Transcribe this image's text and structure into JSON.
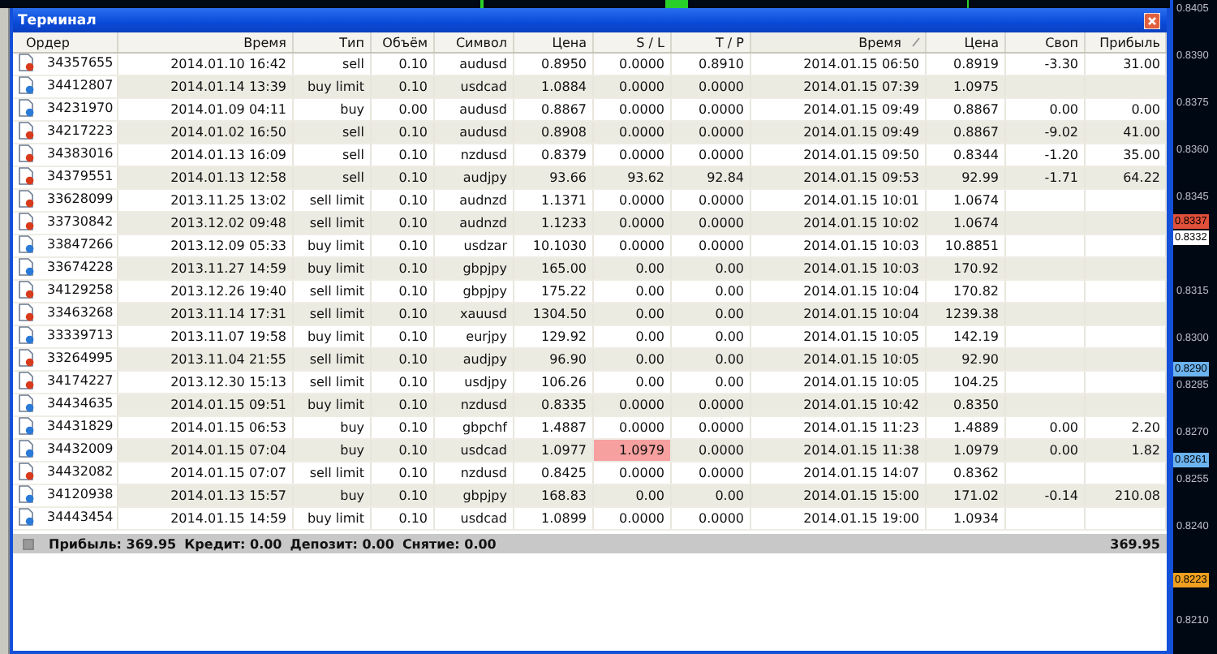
{
  "window": {
    "title": "Терминал"
  },
  "columns": [
    {
      "label": "Ордер",
      "sorted": false
    },
    {
      "label": "Время",
      "sorted": false
    },
    {
      "label": "Тип",
      "sorted": false
    },
    {
      "label": "Объём",
      "sorted": false
    },
    {
      "label": "Символ",
      "sorted": false
    },
    {
      "label": "Цена",
      "sorted": false
    },
    {
      "label": "S / L",
      "sorted": false
    },
    {
      "label": "T / P",
      "sorted": false
    },
    {
      "label": "Время",
      "sorted": true
    },
    {
      "label": "Цена",
      "sorted": false
    },
    {
      "label": "Своп",
      "sorted": false
    },
    {
      "label": "Прибыль",
      "sorted": false
    }
  ],
  "rows": [
    {
      "color": "#d83a1c",
      "sl_alert": false,
      "cells": [
        "34357655",
        "2014.01.10 16:42",
        "sell",
        "0.10",
        "audusd",
        "0.8950",
        "0.0000",
        "0.8910",
        "2014.01.15 06:50",
        "0.8919",
        "-3.30",
        "31.00"
      ]
    },
    {
      "color": "#2a7ad8",
      "sl_alert": false,
      "cells": [
        "34412807",
        "2014.01.14 13:39",
        "buy limit",
        "0.10",
        "usdcad",
        "1.0884",
        "0.0000",
        "0.0000",
        "2014.01.15 07:39",
        "1.0975"
      ]
    },
    {
      "color": "#2a7ad8",
      "sl_alert": false,
      "cells": [
        "34231970",
        "2014.01.09 04:11",
        "buy",
        "0.00",
        "audusd",
        "0.8867",
        "0.0000",
        "0.0000",
        "2014.01.15 09:49",
        "0.8867",
        "0.00",
        "0.00"
      ]
    },
    {
      "color": "#d83a1c",
      "sl_alert": false,
      "cells": [
        "34217223",
        "2014.01.02 16:50",
        "sell",
        "0.10",
        "audusd",
        "0.8908",
        "0.0000",
        "0.0000",
        "2014.01.15 09:49",
        "0.8867",
        "-9.02",
        "41.00"
      ]
    },
    {
      "color": "#d83a1c",
      "sl_alert": false,
      "cells": [
        "34383016",
        "2014.01.13 16:09",
        "sell",
        "0.10",
        "nzdusd",
        "0.8379",
        "0.0000",
        "0.0000",
        "2014.01.15 09:50",
        "0.8344",
        "-1.20",
        "35.00"
      ]
    },
    {
      "color": "#d83a1c",
      "sl_alert": false,
      "cells": [
        "34379551",
        "2014.01.13 12:58",
        "sell",
        "0.10",
        "audjpy",
        "93.66",
        "93.62",
        "92.84",
        "2014.01.15 09:53",
        "92.99",
        "-1.71",
        "64.22"
      ]
    },
    {
      "color": "#d83a1c",
      "sl_alert": false,
      "cells": [
        "33628099",
        "2013.11.25 13:02",
        "sell limit",
        "0.10",
        "audnzd",
        "1.1371",
        "0.0000",
        "0.0000",
        "2014.01.15 10:01",
        "1.0674"
      ]
    },
    {
      "color": "#d83a1c",
      "sl_alert": false,
      "cells": [
        "33730842",
        "2013.12.02 09:48",
        "sell limit",
        "0.10",
        "audnzd",
        "1.1233",
        "0.0000",
        "0.0000",
        "2014.01.15 10:02",
        "1.0674"
      ]
    },
    {
      "color": "#2a7ad8",
      "sl_alert": false,
      "cells": [
        "33847266",
        "2013.12.09 05:33",
        "buy limit",
        "0.10",
        "usdzar",
        "10.1030",
        "0.0000",
        "0.0000",
        "2014.01.15 10:03",
        "10.8851"
      ]
    },
    {
      "color": "#2a7ad8",
      "sl_alert": false,
      "cells": [
        "33674228",
        "2013.11.27 14:59",
        "buy limit",
        "0.10",
        "gbpjpy",
        "165.00",
        "0.00",
        "0.00",
        "2014.01.15 10:03",
        "170.92"
      ]
    },
    {
      "color": "#d83a1c",
      "sl_alert": false,
      "cells": [
        "34129258",
        "2013.12.26 19:40",
        "sell limit",
        "0.10",
        "gbpjpy",
        "175.22",
        "0.00",
        "0.00",
        "2014.01.15 10:04",
        "170.82"
      ]
    },
    {
      "color": "#d83a1c",
      "sl_alert": false,
      "cells": [
        "33463268",
        "2013.11.14 17:31",
        "sell limit",
        "0.10",
        "xauusd",
        "1304.50",
        "0.00",
        "0.00",
        "2014.01.15 10:04",
        "1239.38"
      ]
    },
    {
      "color": "#2a7ad8",
      "sl_alert": false,
      "cells": [
        "33339713",
        "2013.11.07 19:58",
        "buy limit",
        "0.10",
        "eurjpy",
        "129.92",
        "0.00",
        "0.00",
        "2014.01.15 10:05",
        "142.19"
      ]
    },
    {
      "color": "#d83a1c",
      "sl_alert": false,
      "cells": [
        "33264995",
        "2013.11.04 21:55",
        "sell limit",
        "0.10",
        "audjpy",
        "96.90",
        "0.00",
        "0.00",
        "2014.01.15 10:05",
        "92.90"
      ]
    },
    {
      "color": "#d83a1c",
      "sl_alert": false,
      "cells": [
        "34174227",
        "2013.12.30 15:13",
        "sell limit",
        "0.10",
        "usdjpy",
        "106.26",
        "0.00",
        "0.00",
        "2014.01.15 10:05",
        "104.25"
      ]
    },
    {
      "color": "#2a7ad8",
      "sl_alert": false,
      "cells": [
        "34434635",
        "2014.01.15 09:51",
        "buy limit",
        "0.10",
        "nzdusd",
        "0.8335",
        "0.0000",
        "0.0000",
        "2014.01.15 10:42",
        "0.8350"
      ]
    },
    {
      "color": "#2a7ad8",
      "sl_alert": false,
      "cells": [
        "34431829",
        "2014.01.15 06:53",
        "buy",
        "0.10",
        "gbpchf",
        "1.4887",
        "0.0000",
        "0.0000",
        "2014.01.15 11:23",
        "1.4889",
        "0.00",
        "2.20"
      ]
    },
    {
      "color": "#2a7ad8",
      "sl_alert": true,
      "cells": [
        "34432009",
        "2014.01.15 07:04",
        "buy",
        "0.10",
        "usdcad",
        "1.0977",
        "1.0979",
        "0.0000",
        "2014.01.15 11:38",
        "1.0979",
        "0.00",
        "1.82"
      ]
    },
    {
      "color": "#d83a1c",
      "sl_alert": false,
      "cells": [
        "34432082",
        "2014.01.15 07:07",
        "sell limit",
        "0.10",
        "nzdusd",
        "0.8425",
        "0.0000",
        "0.0000",
        "2014.01.15 14:07",
        "0.8362"
      ]
    },
    {
      "color": "#2a7ad8",
      "sl_alert": false,
      "cells": [
        "34120938",
        "2014.01.13 15:57",
        "buy",
        "0.10",
        "gbpjpy",
        "168.83",
        "0.00",
        "0.00",
        "2014.01.15 15:00",
        "171.02",
        "-0.14",
        "210.08"
      ]
    },
    {
      "color": "#2a7ad8",
      "sl_alert": false,
      "cells": [
        "34443454",
        "2014.01.15 14:59",
        "buy limit",
        "0.10",
        "usdcad",
        "1.0899",
        "0.0000",
        "0.0000",
        "2014.01.15 19:00",
        "1.0934"
      ]
    }
  ],
  "summary": {
    "items": [
      "Прибыль: 369.95",
      "Кредит: 0.00",
      "Депозит: 0.00",
      "Снятие: 0.00"
    ],
    "total": "369.95"
  },
  "price_axis": {
    "labels": [
      "0.8405",
      "0.8390",
      "0.8375",
      "0.8360",
      "0.8345",
      "0.8315",
      "0.8300",
      "0.8285",
      "0.8270",
      "0.8255",
      "0.8240",
      "0.8210"
    ],
    "badges": [
      {
        "text": "0.8337",
        "color": "#e0503a"
      },
      {
        "text": "0.8332",
        "color": "#ffffff"
      },
      {
        "text": "0.8290",
        "color": "#6cb4f0"
      },
      {
        "text": "0.8261",
        "color": "#6cb4f0"
      },
      {
        "text": "0.8223",
        "color": "#f0a020"
      }
    ]
  }
}
